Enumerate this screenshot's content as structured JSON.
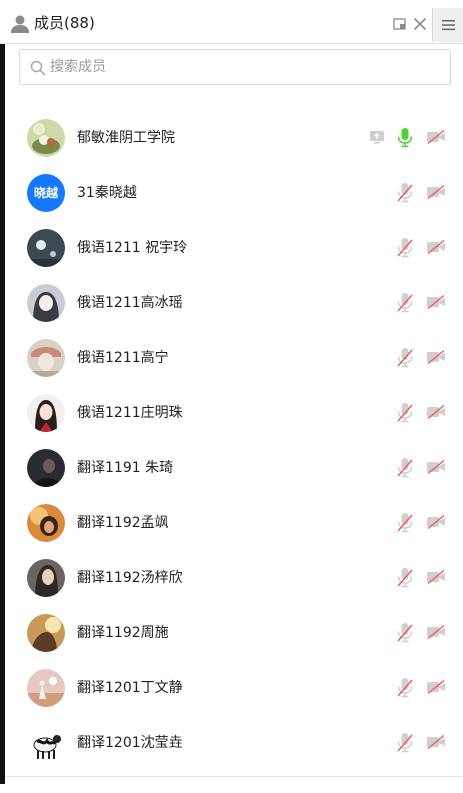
{
  "header": {
    "title": "成员(88)"
  },
  "search": {
    "placeholder": "搜索成员"
  },
  "colors": {
    "mic_active": "#4cd137",
    "muted_slash": "#f05a5a",
    "icon_gray": "#cfcfcf",
    "accent": "#1677ff"
  },
  "members": [
    {
      "name": "郁敏淮阴工学院",
      "avatar": "photo",
      "avatar_text": "",
      "screen_share": true,
      "mic_on": true,
      "cam_on": false
    },
    {
      "name": "31秦晓越",
      "avatar": "text",
      "avatar_text": "晓越",
      "screen_share": false,
      "mic_on": false,
      "cam_on": false
    },
    {
      "name": "俄语1211 祝宇玲",
      "avatar": "photo",
      "avatar_text": "",
      "screen_share": false,
      "mic_on": false,
      "cam_on": false
    },
    {
      "name": "俄语1211高冰瑶",
      "avatar": "photo",
      "avatar_text": "",
      "screen_share": false,
      "mic_on": false,
      "cam_on": false
    },
    {
      "name": "俄语1211高宁",
      "avatar": "photo",
      "avatar_text": "",
      "screen_share": false,
      "mic_on": false,
      "cam_on": false
    },
    {
      "name": "俄语1211庄明珠",
      "avatar": "photo",
      "avatar_text": "",
      "screen_share": false,
      "mic_on": false,
      "cam_on": false
    },
    {
      "name": "翻译1191 朱琦",
      "avatar": "photo",
      "avatar_text": "",
      "screen_share": false,
      "mic_on": false,
      "cam_on": false
    },
    {
      "name": "翻译1192孟飒",
      "avatar": "photo",
      "avatar_text": "",
      "screen_share": false,
      "mic_on": false,
      "cam_on": false
    },
    {
      "name": "翻译1192汤梓欣",
      "avatar": "photo",
      "avatar_text": "",
      "screen_share": false,
      "mic_on": false,
      "cam_on": false
    },
    {
      "name": "翻译1192周施",
      "avatar": "photo",
      "avatar_text": "",
      "screen_share": false,
      "mic_on": false,
      "cam_on": false
    },
    {
      "name": "翻译1201丁文静",
      "avatar": "photo",
      "avatar_text": "",
      "screen_share": false,
      "mic_on": false,
      "cam_on": false
    },
    {
      "name": "翻译1201沈莹垚",
      "avatar": "photo",
      "avatar_text": "",
      "screen_share": false,
      "mic_on": false,
      "cam_on": false
    }
  ]
}
